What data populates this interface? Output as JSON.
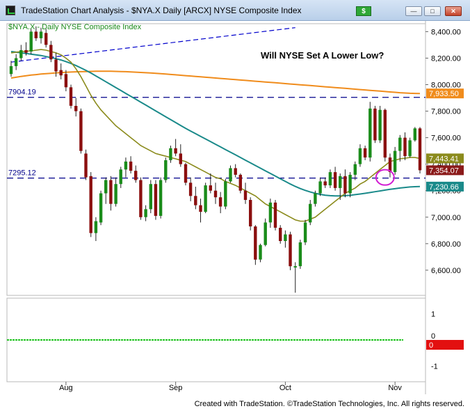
{
  "window": {
    "title": "TradeStation Chart Analysis - $NYA.X Daily [ARCX] NYSE Composite Index",
    "s_button": "$",
    "minimize_glyph": "—",
    "restore_glyph": "□",
    "close_glyph": "✕"
  },
  "chart_data": {
    "type": "candlestick",
    "symbol_label": "$NYA.X - Daily  NYSE Composite Index",
    "annotation": "Will NYSE Set A Lower Low?",
    "y_ticks": [
      6600,
      6800,
      7000,
      7200,
      7400,
      7600,
      7800,
      8000,
      8200,
      8400
    ],
    "y_tick_labels": [
      "6,600.00",
      "6,800.00",
      "7,000.00",
      "7,200.00",
      "7,400.00",
      "7,600.00",
      "7,800.00",
      "8,000.00",
      "8,200.00",
      "8,400.00"
    ],
    "ylim": [
      6410,
      8460
    ],
    "x_month_labels": [
      {
        "label": "Aug",
        "index": 11
      },
      {
        "label": "Sep",
        "index": 33
      },
      {
        "label": "Oct",
        "index": 55
      },
      {
        "label": "Nov",
        "index": 77
      }
    ],
    "horizontal_levels": [
      {
        "label": "7904.19",
        "value": 7904.19
      },
      {
        "label": "7295.12",
        "value": 7295.12
      }
    ],
    "price_tags": [
      {
        "label": "7,933.50",
        "value": 7933.5,
        "color": "#f08c1c"
      },
      {
        "label": "7,443.41",
        "value": 7443.41,
        "color": "#8b8b1c"
      },
      {
        "label": "7,354.07",
        "value": 7354.07,
        "color": "#8b1a1a"
      },
      {
        "label": "7,230.66",
        "value": 7230.66,
        "color": "#1a8a8a"
      }
    ],
    "candles": [
      [
        8080,
        8180,
        8060,
        8140
      ],
      [
        8140,
        8230,
        8110,
        8200
      ],
      [
        8200,
        8300,
        8180,
        8260
      ],
      [
        8260,
        8320,
        8220,
        8240
      ],
      [
        8250,
        8420,
        8230,
        8400
      ],
      [
        8400,
        8440,
        8330,
        8350
      ],
      [
        8350,
        8430,
        8310,
        8400
      ],
      [
        8390,
        8420,
        8280,
        8300
      ],
      [
        8300,
        8330,
        8170,
        8190
      ],
      [
        8190,
        8240,
        8060,
        8100
      ],
      [
        8110,
        8160,
        8040,
        8070
      ],
      [
        8080,
        8110,
        7950,
        7980
      ],
      [
        7980,
        8000,
        7820,
        7840
      ],
      [
        7840,
        7900,
        7760,
        7800
      ],
      [
        7800,
        7820,
        7480,
        7500
      ],
      [
        7480,
        7510,
        7280,
        7300
      ],
      [
        7310,
        7340,
        6850,
        6880
      ],
      [
        6880,
        7000,
        6820,
        6970
      ],
      [
        6960,
        7200,
        6940,
        7180
      ],
      [
        7180,
        7300,
        7100,
        7280
      ],
      [
        7280,
        7310,
        7050,
        7100
      ],
      [
        7100,
        7300,
        7080,
        7250
      ],
      [
        7250,
        7380,
        7220,
        7360
      ],
      [
        7360,
        7450,
        7300,
        7420
      ],
      [
        7420,
        7460,
        7330,
        7350
      ],
      [
        7350,
        7390,
        7260,
        7280
      ],
      [
        7280,
        7300,
        6980,
        7000
      ],
      [
        7000,
        7090,
        6970,
        7060
      ],
      [
        7060,
        7280,
        7030,
        7250
      ],
      [
        7250,
        7280,
        6980,
        7010
      ],
      [
        7010,
        7300,
        6990,
        7280
      ],
      [
        7280,
        7450,
        7260,
        7430
      ],
      [
        7430,
        7540,
        7410,
        7520
      ],
      [
        7520,
        7590,
        7460,
        7480
      ],
      [
        7480,
        7550,
        7380,
        7400
      ],
      [
        7400,
        7410,
        7240,
        7260
      ],
      [
        7260,
        7300,
        7120,
        7160
      ],
      [
        7160,
        7230,
        7060,
        7090
      ],
      [
        7090,
        7140,
        6960,
        7040
      ],
      [
        7040,
        7260,
        7030,
        7240
      ],
      [
        7240,
        7330,
        7180,
        7200
      ],
      [
        7200,
        7260,
        7100,
        7150
      ],
      [
        7150,
        7190,
        7030,
        7080
      ],
      [
        7080,
        7290,
        7060,
        7270
      ],
      [
        7270,
        7390,
        7260,
        7370
      ],
      [
        7370,
        7400,
        7300,
        7320
      ],
      [
        7320,
        7330,
        7180,
        7200
      ],
      [
        7200,
        7260,
        7100,
        7130
      ],
      [
        7130,
        7150,
        6900,
        6930
      ],
      [
        6930,
        6940,
        6640,
        6680
      ],
      [
        6680,
        6800,
        6660,
        6790
      ],
      [
        6790,
        6990,
        6780,
        6960
      ],
      [
        6960,
        7140,
        6920,
        7110
      ],
      [
        7110,
        7130,
        6900,
        6920
      ],
      [
        6920,
        6940,
        6800,
        6820
      ],
      [
        6820,
        6900,
        6770,
        6870
      ],
      [
        6870,
        6890,
        6600,
        6630
      ],
      [
        6620,
        6660,
        6430,
        6630
      ],
      [
        6630,
        6830,
        6610,
        6810
      ],
      [
        6810,
        6980,
        6790,
        6960
      ],
      [
        6960,
        7130,
        6940,
        7100
      ],
      [
        7100,
        7200,
        7080,
        7180
      ],
      [
        7180,
        7300,
        7160,
        7270
      ],
      [
        7270,
        7300,
        7220,
        7240
      ],
      [
        7240,
        7360,
        7220,
        7340
      ],
      [
        7340,
        7380,
        7200,
        7220
      ],
      [
        7220,
        7330,
        7130,
        7310
      ],
      [
        7310,
        7360,
        7150,
        7180
      ],
      [
        7180,
        7340,
        7150,
        7320
      ],
      [
        7320,
        7420,
        7280,
        7400
      ],
      [
        7400,
        7550,
        7380,
        7520
      ],
      [
        7520,
        7540,
        7430,
        7450
      ],
      [
        7450,
        7870,
        7420,
        7820
      ],
      [
        7820,
        7840,
        7560,
        7580
      ],
      [
        7580,
        7840,
        7560,
        7810
      ],
      [
        7810,
        7820,
        7420,
        7450
      ],
      [
        7450,
        7480,
        7300,
        7340
      ],
      [
        7340,
        7530,
        7320,
        7500
      ],
      [
        7500,
        7620,
        7420,
        7600
      ],
      [
        7600,
        7640,
        7430,
        7460
      ],
      [
        7460,
        7600,
        7450,
        7580
      ],
      [
        7580,
        7680,
        7570,
        7670
      ],
      [
        7670,
        7680,
        7330,
        7354
      ]
    ],
    "ma20": [
      8240,
      8245,
      8250,
      8252,
      8255,
      8260,
      8265,
      8260,
      8250,
      8240,
      8225,
      8200,
      8170,
      8120,
      8060,
      7990,
      7920,
      7860,
      7810,
      7770,
      7730,
      7690,
      7660,
      7630,
      7600,
      7570,
      7540,
      7520,
      7500,
      7480,
      7470,
      7460,
      7450,
      7440,
      7430,
      7420,
      7400,
      7380,
      7360,
      7340,
      7320,
      7300,
      7290,
      7270,
      7255,
      7240,
      7220,
      7200,
      7180,
      7160,
      7130,
      7100,
      7080,
      7060,
      7040,
      7020,
      7000,
      6980,
      6970,
      6970,
      6985,
      7000,
      7030,
      7060,
      7090,
      7120,
      7150,
      7180,
      7200,
      7220,
      7250,
      7270,
      7300,
      7330,
      7360,
      7390,
      7420,
      7430,
      7440,
      7445,
      7450,
      7450,
      7443
    ],
    "ma50": [
      8250,
      8245,
      8240,
      8235,
      8230,
      8225,
      8220,
      8212,
      8204,
      8196,
      8186,
      8174,
      8160,
      8144,
      8126,
      8108,
      8088,
      8066,
      8044,
      8022,
      8000,
      7978,
      7956,
      7934,
      7912,
      7890,
      7868,
      7846,
      7824,
      7802,
      7780,
      7758,
      7736,
      7714,
      7692,
      7670,
      7650,
      7630,
      7610,
      7590,
      7570,
      7550,
      7530,
      7510,
      7490,
      7470,
      7450,
      7430,
      7410,
      7390,
      7370,
      7350,
      7330,
      7310,
      7290,
      7270,
      7250,
      7232,
      7216,
      7202,
      7190,
      7180,
      7172,
      7166,
      7162,
      7160,
      7160,
      7162,
      7165,
      7170,
      7175,
      7180,
      7186,
      7192,
      7198,
      7204,
      7210,
      7215,
      7220,
      7224,
      7228,
      7230,
      7231
    ],
    "ma200": [
      8050,
      8056,
      8062,
      8067,
      8072,
      8076,
      8080,
      8083,
      8086,
      8089,
      8091,
      8093,
      8095,
      8097,
      8098,
      8099,
      8100,
      8101,
      8101,
      8101,
      8101,
      8100,
      8099,
      8098,
      8096,
      8094,
      8092,
      8090,
      8088,
      8086,
      8083,
      8080,
      8077,
      8074,
      8071,
      8068,
      8065,
      8062,
      8059,
      8056,
      8053,
      8050,
      8047,
      8044,
      8041,
      8038,
      8035,
      8032,
      8029,
      8026,
      8023,
      8020,
      8017,
      8014,
      8011,
      8008,
      8005,
      8002,
      7999,
      7996,
      7993,
      7990,
      7987,
      7984,
      7981,
      7978,
      7975,
      7972,
      7969,
      7966,
      7963,
      7960,
      7957,
      7954,
      7951,
      7948,
      7945,
      7942,
      7939,
      7937,
      7935,
      7934,
      7933.5
    ],
    "trendline": [
      {
        "index": 0,
        "value": 8170
      },
      {
        "index": 57,
        "value": 8430
      }
    ],
    "circle_marker": {
      "index": 75,
      "value": 7300
    },
    "indicator": {
      "y_ticks": [
        -1,
        0,
        0,
        1
      ],
      "y_tick_labels": [
        "-1",
        "-0",
        "0",
        "1"
      ],
      "ylim": [
        -1.6,
        1.6
      ],
      "zero_value_tag": "0",
      "line_value": 0
    }
  },
  "footer": "Created with TradeStation. ©TradeStation Technologies, Inc. All rights reserved."
}
